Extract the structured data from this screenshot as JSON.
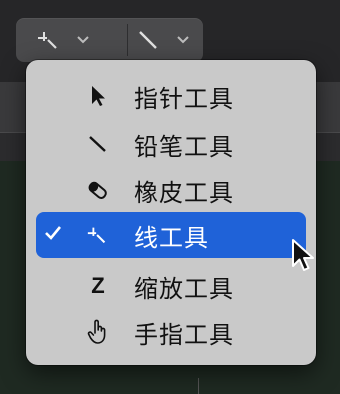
{
  "toolbar": {
    "left_tool_icon": "line-tool-icon",
    "right_tool_icon": "pencil-icon",
    "chevron_icon": "chevron-down-icon"
  },
  "menu": {
    "items": [
      {
        "label": "指针工具",
        "icon": "pointer-icon",
        "selected": false
      },
      {
        "label": "铅笔工具",
        "icon": "pencil-icon",
        "selected": false
      },
      {
        "label": "橡皮工具",
        "icon": "eraser-icon",
        "selected": false
      },
      {
        "label": "线工具",
        "icon": "line-tool-icon",
        "selected": true,
        "check": "✓"
      },
      {
        "label": "缩放工具",
        "icon": "zoom-icon",
        "icon_text": "Z",
        "selected": false
      },
      {
        "label": "手指工具",
        "icon": "hand-icon",
        "selected": false
      }
    ]
  },
  "colors": {
    "menu_bg": "#c9c9c9",
    "selection": "#1f62d8",
    "toolbar_button": "#4a4a4c"
  }
}
